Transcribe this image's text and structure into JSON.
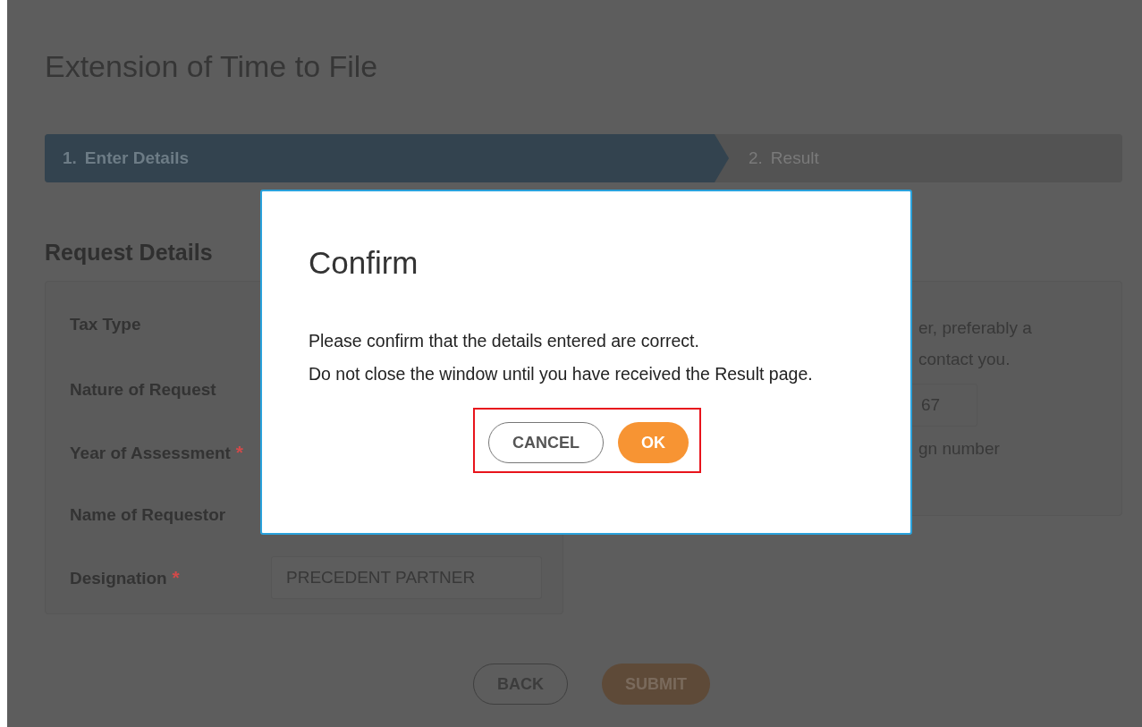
{
  "page": {
    "title": "Extension of Time to File"
  },
  "steps": [
    {
      "number": "1.",
      "label": "Enter Details",
      "selected": true
    },
    {
      "number": "2.",
      "label": "Result",
      "selected": false
    }
  ],
  "section": {
    "heading": "Request Details"
  },
  "form": {
    "fields": [
      {
        "label": "Tax Type",
        "required": false
      },
      {
        "label": "Nature of Request",
        "required": false
      },
      {
        "label": "Year of Assessment",
        "required": true,
        "required_mark": "*"
      },
      {
        "label": "Name of Requestor",
        "required": false
      },
      {
        "label": "Designation",
        "required": true,
        "required_mark": "*",
        "value": "PRECEDENT PARTNER"
      }
    ]
  },
  "contact_panel": {
    "text_lines": [
      "er, preferably a",
      "contact you."
    ],
    "field_value": "67",
    "note": "gn number"
  },
  "actions": {
    "buttons": [
      {
        "label": "BACK",
        "kind": "secondary"
      },
      {
        "label": "SUBMIT",
        "kind": "primary"
      }
    ]
  },
  "dialog": {
    "title": "Confirm",
    "message_lines": [
      "Please confirm that the details entered are correct.",
      "Do not close the window until you have received the Result page."
    ],
    "highlighted": true,
    "buttons": [
      {
        "label": "CANCEL",
        "kind": "secondary"
      },
      {
        "label": "OK",
        "kind": "primary"
      }
    ]
  }
}
